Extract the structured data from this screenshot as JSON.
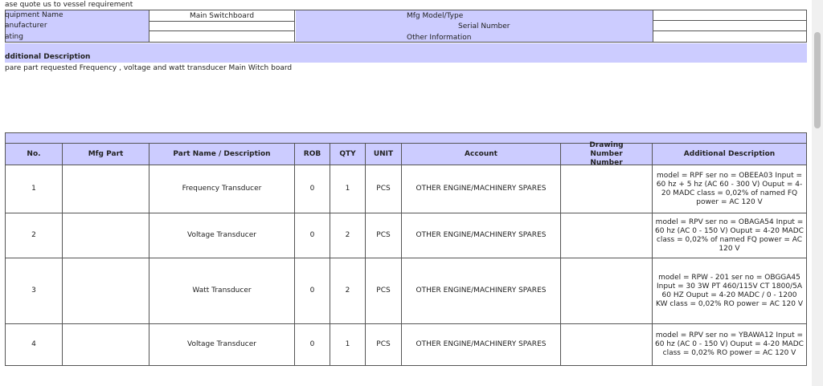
{
  "quote_notice": "ase quote us to vessel requirement",
  "equipment": {
    "equipment_name_label": "quipment Name",
    "manufacturer_label": "anufacturer",
    "rating_label": "ating",
    "equipment_name_value": "Main Switchboard",
    "manufacturer_value": "",
    "rating_value": "",
    "mfg_model_label": "Mfg Model/Type",
    "serial_label": "Serial Number",
    "other_info_label": "Other Information",
    "mfg_model_value": "",
    "serial_value": "",
    "other_info_value": ""
  },
  "additional": {
    "heading": "dditional Description",
    "text": "pare part requested Frequency , voltage and watt transducer Main Witch board"
  },
  "table": {
    "headers": {
      "no": "No.",
      "mfg_part": "Mfg Part",
      "part_name": "Part Name / Description",
      "rob": "ROB",
      "qty": "QTY",
      "unit": "UNIT",
      "account": "Account",
      "drawing": "Drawing Number Number",
      "add_desc": "Additional Description"
    },
    "rows": [
      {
        "no": "1",
        "mfg_part": "",
        "part_name": "Frequency Transducer",
        "rob": "0",
        "qty": "1",
        "unit": "PCS",
        "account": "OTHER ENGINE/MACHINERY SPARES",
        "drawing": "",
        "add_desc": "model = RPF   ser no = OBEEA03 Input = 60 hz + 5 hz (AC 60 - 300 V)  Ouput = 4-20 MADC class = 0,02% of named FQ  power = AC 120 V"
      },
      {
        "no": "2",
        "mfg_part": "",
        "part_name": "Voltage Transducer",
        "rob": "0",
        "qty": "2",
        "unit": "PCS",
        "account": "OTHER ENGINE/MACHINERY SPARES",
        "drawing": "",
        "add_desc": "model = RPV   ser no = OBAGA54 Input = 60 hz  (AC 0 - 150 V) Ouput = 4-20 MADC class = 0,02% of named FQ  power = AC 120 V"
      },
      {
        "no": "3",
        "mfg_part": "",
        "part_name": "Watt Transducer",
        "rob": "0",
        "qty": "2",
        "unit": "PCS",
        "account": "OTHER ENGINE/MACHINERY SPARES",
        "drawing": "",
        "add_desc": "model = RPW - 201  ser no = OBGGA45  Input = 30 3W  PT 460/115V  CT 1800/5A 60 HZ  Ouput = 4-20 MADC / 0 - 1200 KW class = 0,02% RO   power = AC 120 V"
      },
      {
        "no": "4",
        "mfg_part": "",
        "part_name": "Voltage Transducer",
        "rob": "0",
        "qty": "1",
        "unit": "PCS",
        "account": "OTHER ENGINE/MACHINERY SPARES",
        "drawing": "",
        "add_desc": "model = RPV   ser no = YBAWA12 Input = 60 hz  (AC 0 - 150 V) Ouput = 4-20 MADC class = 0,02% RO  power = AC 120 V"
      }
    ]
  },
  "colors": {
    "header_fill": "#ccccff",
    "border": "#555555"
  }
}
